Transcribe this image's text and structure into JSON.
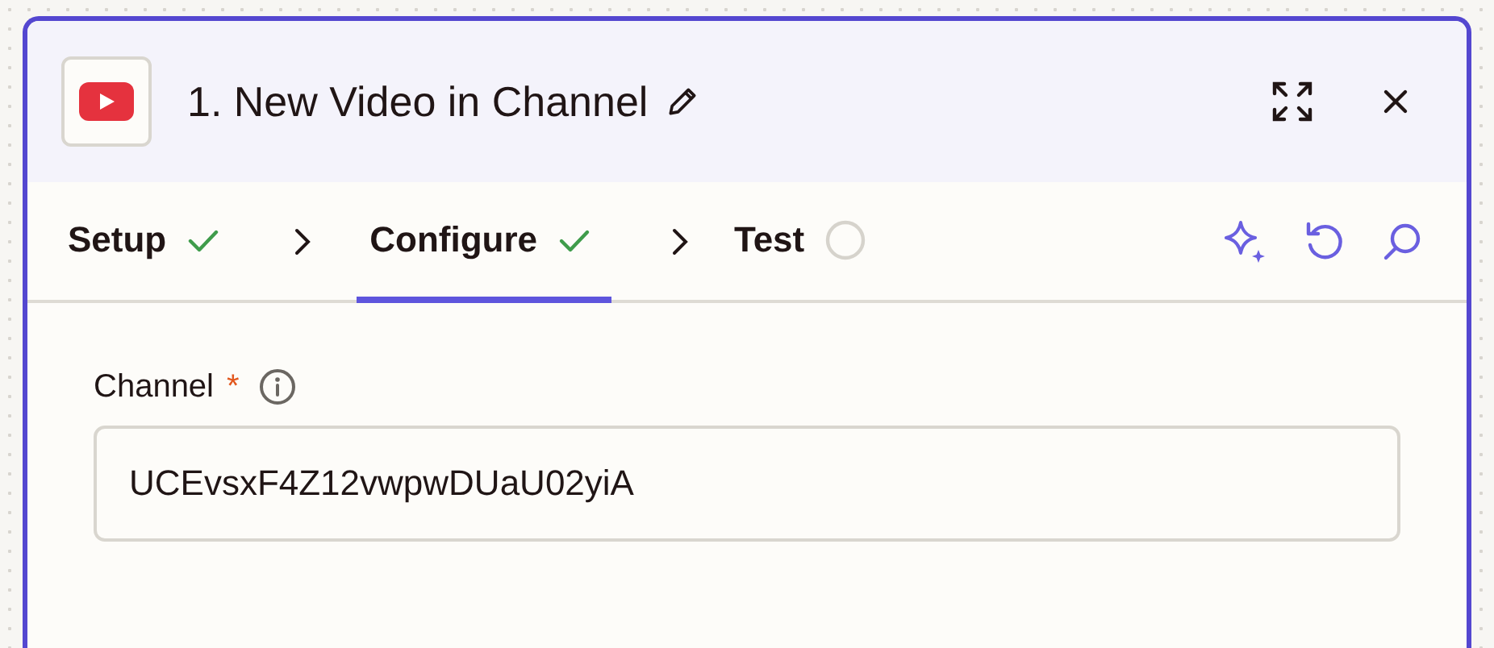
{
  "header": {
    "title": "1. New Video in Channel"
  },
  "steps": [
    {
      "label": "Setup",
      "complete": true,
      "selected": false
    },
    {
      "label": "Configure",
      "complete": true,
      "selected": true
    },
    {
      "label": "Test",
      "complete": false,
      "selected": false
    }
  ],
  "field": {
    "label": "Channel",
    "required": true,
    "required_mark": "*",
    "value": "UCEvsxF4Z12vwpwDUaU02yiA"
  }
}
